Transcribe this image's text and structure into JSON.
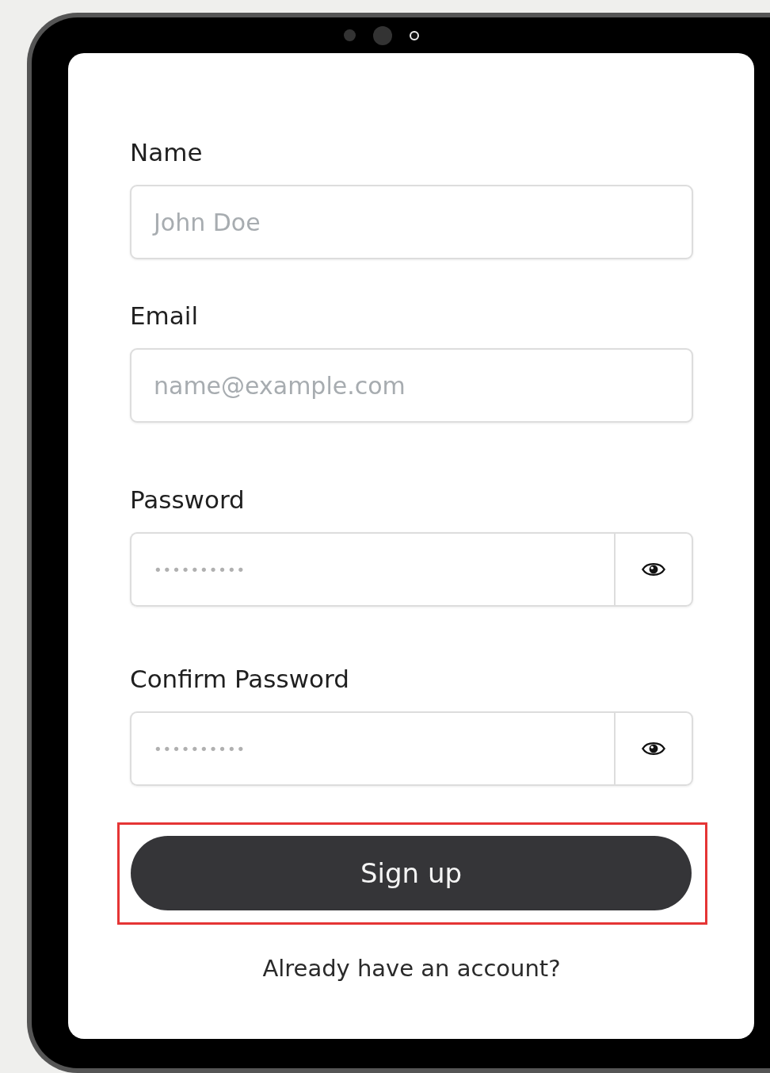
{
  "form": {
    "fields": [
      {
        "kind": "text",
        "label": "Name",
        "placeholder": "John Doe"
      },
      {
        "kind": "text",
        "label": "Email",
        "placeholder": "name@example.com"
      },
      {
        "kind": "password",
        "label": "Password",
        "value": "••••••••••"
      },
      {
        "kind": "password",
        "label": "Confirm Password",
        "value": "••••••••••"
      }
    ],
    "submit": {
      "label": "Sign up",
      "highlighted": true
    },
    "footer_link": "Already have an account?"
  }
}
